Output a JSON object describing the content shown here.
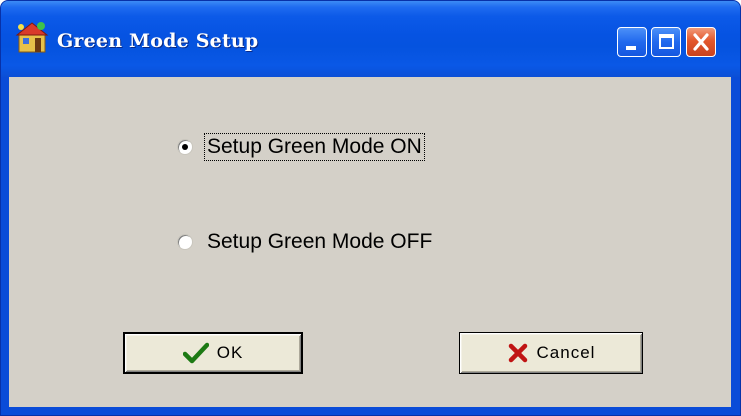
{
  "window": {
    "title": "Green Mode Setup"
  },
  "icons": {
    "app": "app-icon",
    "minimize": "minimize-icon",
    "maximize": "maximize-icon",
    "close": "close-icon",
    "ok": "checkmark-icon",
    "cancel": "x-icon"
  },
  "options": {
    "on": {
      "label": "Setup Green Mode ON",
      "selected": true
    },
    "off": {
      "label": "Setup Green Mode OFF",
      "selected": false
    }
  },
  "buttons": {
    "ok": "OK",
    "cancel": "Cancel"
  },
  "colors": {
    "titlebar": "#0653e2",
    "client": "#d4d0c8",
    "close_button": "#e3582d",
    "ok_check": "#1d7a14",
    "cancel_x": "#c01414"
  }
}
